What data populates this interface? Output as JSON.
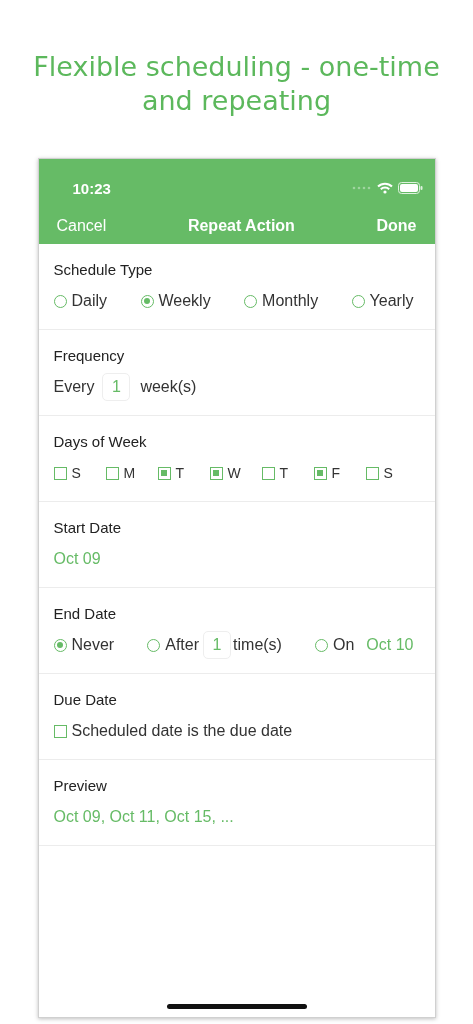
{
  "headline": "Flexible scheduling - one-time and repeating",
  "status_bar": {
    "time": "10:23"
  },
  "nav": {
    "cancel": "Cancel",
    "title": "Repeat Action",
    "done": "Done"
  },
  "schedule_type": {
    "label": "Schedule Type",
    "options": [
      {
        "label": "Daily",
        "selected": false
      },
      {
        "label": "Weekly",
        "selected": true
      },
      {
        "label": "Monthly",
        "selected": false
      },
      {
        "label": "Yearly",
        "selected": false
      }
    ]
  },
  "frequency": {
    "label": "Frequency",
    "prefix": "Every",
    "value": "1",
    "suffix": "week(s)"
  },
  "days_of_week": {
    "label": "Days of Week",
    "days": [
      {
        "label": "S",
        "checked": false
      },
      {
        "label": "M",
        "checked": false
      },
      {
        "label": "T",
        "checked": true
      },
      {
        "label": "W",
        "checked": true
      },
      {
        "label": "T",
        "checked": false
      },
      {
        "label": "F",
        "checked": true
      },
      {
        "label": "S",
        "checked": false
      }
    ]
  },
  "start_date": {
    "label": "Start Date",
    "value": "Oct 09"
  },
  "end_date": {
    "label": "End Date",
    "options": [
      {
        "kind": "plain",
        "label": "Never",
        "selected": true
      },
      {
        "kind": "count",
        "label": "After",
        "selected": false,
        "value": "1",
        "suffix": "time(s)"
      },
      {
        "kind": "date",
        "label": "On",
        "selected": false,
        "value": "Oct 10"
      }
    ]
  },
  "due_date": {
    "label": "Due Date",
    "checkbox": {
      "label": "Scheduled date is the due date",
      "checked": false
    }
  },
  "preview": {
    "label": "Preview",
    "value": "Oct 09, Oct 11, Oct 15, ..."
  }
}
